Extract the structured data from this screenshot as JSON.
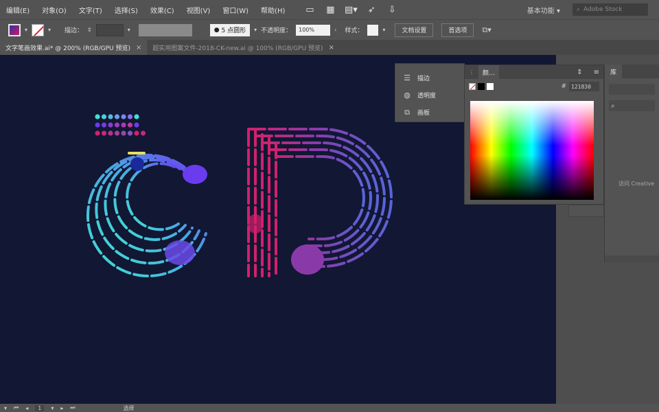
{
  "menubar": {
    "items": [
      "编辑(E)",
      "对象(O)",
      "文字(T)",
      "选择(S)",
      "效果(C)",
      "视图(V)",
      "窗口(W)",
      "帮助(H)"
    ],
    "workspace": "基本功能",
    "search_placeholder": "Adobe Stock"
  },
  "controlbar": {
    "stroke_label": "描边：",
    "brush_value": "5 点圆形",
    "opacity_label": "不透明度：",
    "opacity_value": "100%",
    "style_label": "样式：",
    "doc_setup_label": "文档设置",
    "preferences_label": "首选项"
  },
  "tabs": [
    {
      "label": "文字笔画效果.ai* @ 200% (RGB/GPU 预览)",
      "active": true
    },
    {
      "label": "超实用图案文件-2018-CK-new.ai @ 100% (RGB/GPU 预览)",
      "active": false
    }
  ],
  "mini_panel": {
    "items": [
      {
        "label": "描边",
        "icon": "stroke-lines-icon"
      },
      {
        "label": "透明度",
        "icon": "transparency-icon"
      },
      {
        "label": "画板",
        "icon": "artboard-icon"
      }
    ]
  },
  "color_panel": {
    "tab_label": "颜…",
    "hex_value": "121830"
  },
  "library_panel": {
    "tab_label": "库",
    "hint_text": "访问 Creative"
  },
  "statusbar": {
    "zoom_value": "1",
    "tool_name": "选择"
  },
  "colors": {
    "canvas_bg": "#121733",
    "letter_c_start": "#3fe2d0",
    "letter_c_end": "#6a3cf0",
    "letter_d_pink": "#d4206c",
    "letter_d_blue": "#5a64d8"
  },
  "canvas_art": {
    "letters": [
      "C",
      "D"
    ],
    "swatch_rows": 3
  }
}
